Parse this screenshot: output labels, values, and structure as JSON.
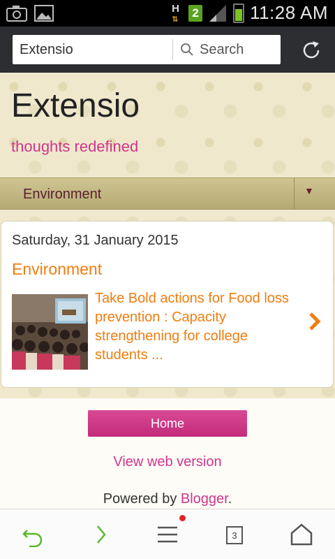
{
  "status_bar": {
    "time": "11:28 AM",
    "network": "H",
    "sim": "2"
  },
  "browser": {
    "url_text": "Extensio",
    "search_label": "Search"
  },
  "blog": {
    "title": "Extensio",
    "tagline": "thoughts redefined",
    "nav_selected": "Environment",
    "post": {
      "date": "Saturday, 31 January 2015",
      "category": "Environment",
      "link_text": "Take Bold actions for Food loss prevention : Capacity strengthening for college students ..."
    },
    "home_button": "Home",
    "web_version": "View web version",
    "powered_by": "Powered by",
    "blogger": "Blogger",
    "period": "."
  },
  "bottom_bar": {
    "tab_count": "3"
  },
  "colors": {
    "accent_pink": "#d0358d",
    "accent_orange": "#f07d10"
  }
}
